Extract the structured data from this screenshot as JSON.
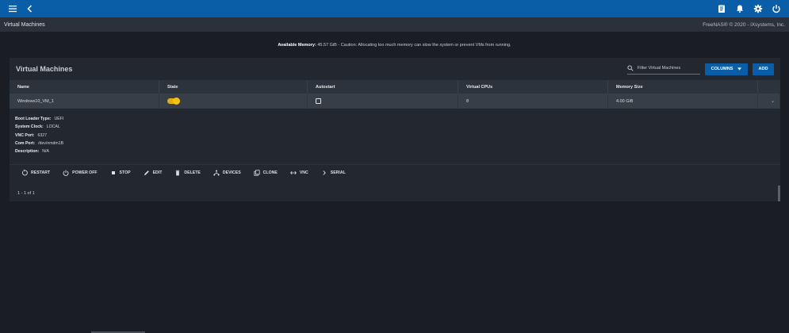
{
  "topbar": {
    "menu_icon": "hamburger-icon",
    "back_icon": "chevron-left-icon",
    "right_icons": [
      "clipboard-icon",
      "bell-icon",
      "gear-icon",
      "power-icon"
    ]
  },
  "pagebar": {
    "breadcrumb": "Virtual Machines",
    "copyright": "FreeNAS® © 2020 - iXsystems, Inc."
  },
  "memory": {
    "label": "Available Memory:",
    "text": "45.57 GiB - Caution: Allocating too much memory can slow the system or prevent VMs from running."
  },
  "card": {
    "title": "Virtual Machines",
    "filter_placeholder": "Filter Virtual Machines",
    "columns_label": "COLUMNS",
    "add_label": "ADD"
  },
  "table": {
    "headers": [
      "Name",
      "State",
      "Autostart",
      "Virtual CPUs",
      "Memory Size"
    ],
    "row": {
      "name": "Windows10_VM_1",
      "state_on": true,
      "autostart": false,
      "vcpus": "8",
      "memory": "4.00 GiB"
    }
  },
  "details": [
    {
      "key": "Boot Loader Type:",
      "value": "UEFI"
    },
    {
      "key": "System Clock:",
      "value": "LOCAL"
    },
    {
      "key": "VNC Port:",
      "value": "6327"
    },
    {
      "key": "Com Port:",
      "value": "/dev/nmdm1B"
    },
    {
      "key": "Description:",
      "value": "N/A"
    }
  ],
  "actions": [
    "RESTART",
    "POWER OFF",
    "STOP",
    "EDIT",
    "DELETE",
    "DEVICES",
    "CLONE",
    "VNC",
    "SERIAL"
  ],
  "pager": "1 - 1 of 1",
  "colors": {
    "accent": "#0a5ea8",
    "toggle": "#f5c211"
  }
}
